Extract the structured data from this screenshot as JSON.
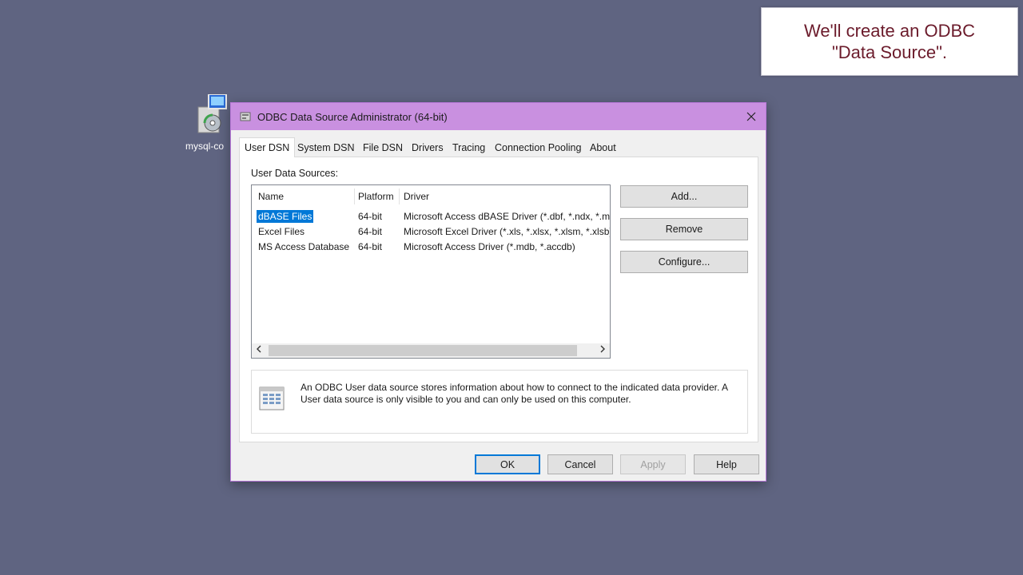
{
  "desktop": {
    "icon_label": "mysql-co",
    "icon_name": "installer-icon"
  },
  "callout": {
    "text": "We'll create an ODBC\n\"Data Source\"."
  },
  "window": {
    "title": "ODBC Data Source Administrator (64-bit)",
    "close_icon": "close-icon",
    "accent": "#c990e0"
  },
  "tabs": [
    {
      "label": "User DSN",
      "active": true
    },
    {
      "label": "System DSN"
    },
    {
      "label": "File DSN"
    },
    {
      "label": "Drivers"
    },
    {
      "label": "Tracing"
    },
    {
      "label": "Connection Pooling"
    },
    {
      "label": "About"
    }
  ],
  "user_dsn": {
    "section_label": "User Data Sources:",
    "columns": [
      "Name",
      "Platform",
      "Driver"
    ],
    "rows": [
      {
        "name": "dBASE Files",
        "platform": "64-bit",
        "driver": "Microsoft Access dBASE Driver (*.dbf, *.ndx, *.m",
        "selected": true
      },
      {
        "name": "Excel Files",
        "platform": "64-bit",
        "driver": "Microsoft Excel Driver (*.xls, *.xlsx, *.xlsm, *.xlsb)"
      },
      {
        "name": "MS Access Database",
        "platform": "64-bit",
        "driver": "Microsoft Access Driver (*.mdb, *.accdb)"
      }
    ],
    "buttons": {
      "add": "Add...",
      "remove": "Remove",
      "configure": "Configure..."
    },
    "info_text": "An ODBC User data source stores information about how to connect to the indicated data provider.   A User data source is only visible to you and can only be used on this computer."
  },
  "footer": {
    "ok": "OK",
    "cancel": "Cancel",
    "apply": "Apply",
    "help": "Help"
  }
}
